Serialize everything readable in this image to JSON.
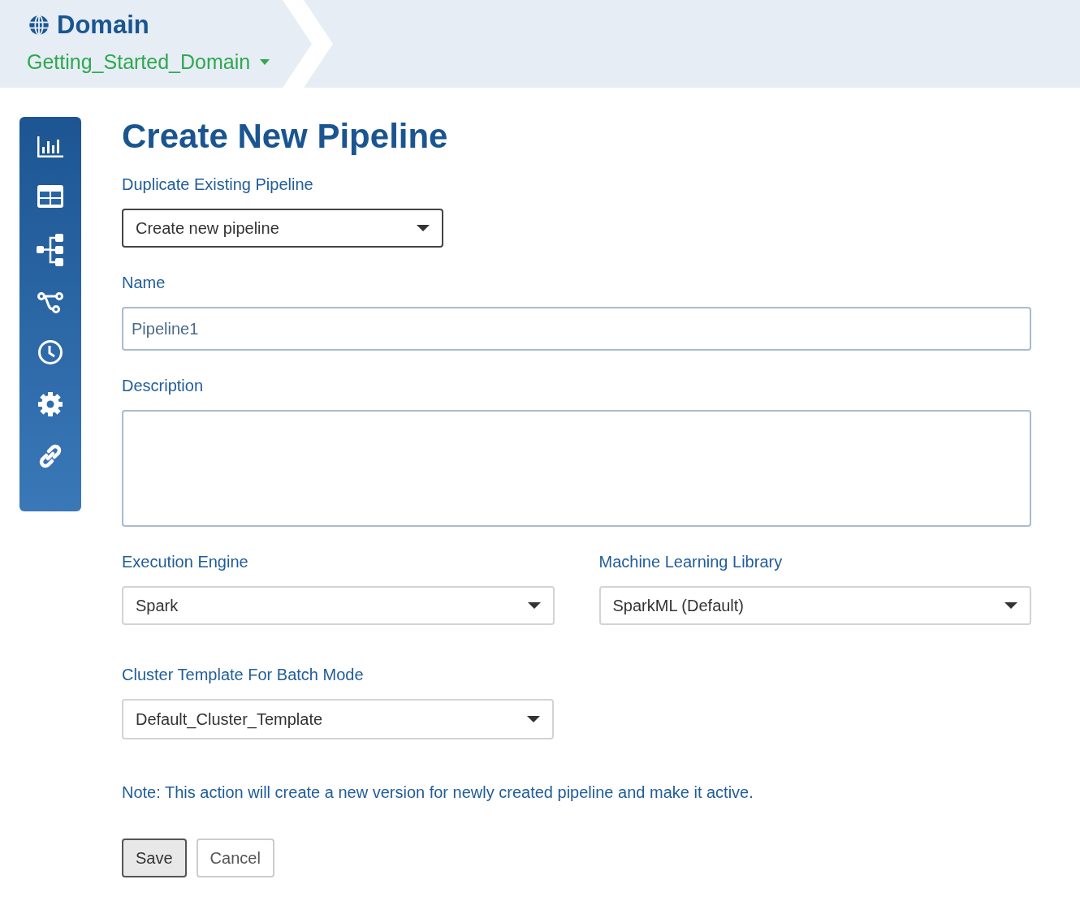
{
  "header": {
    "title": "Domain",
    "domain": "Getting_Started_Domain"
  },
  "page_title": "Create New Pipeline",
  "fields": [
    {
      "kind": "select",
      "label": "Duplicate Existing Pipeline",
      "value": "Create new pipeline"
    },
    {
      "kind": "input",
      "label": "Name",
      "value": "Pipeline1"
    },
    {
      "kind": "textarea",
      "label": "Description"
    }
  ],
  "engine_row": [
    {
      "label": "Execution Engine",
      "value": "Spark"
    },
    {
      "label": "Machine Learning Library",
      "value": "SparkML (Default)"
    }
  ],
  "cluster": {
    "label": "Cluster Template For Batch Mode",
    "value": "Default_Cluster_Template"
  },
  "note": "Note: This action will create a new version for newly created pipeline and make it active.",
  "buttons": [
    {
      "label": "Save",
      "focused": true
    },
    {
      "label": "Cancel",
      "focused": false
    }
  ]
}
